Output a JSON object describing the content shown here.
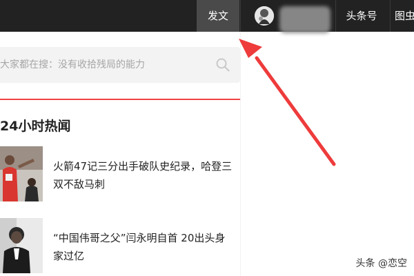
{
  "topbar": {
    "publish_label": "发文",
    "toutiao_label": "头条号",
    "partial_label": "图虫"
  },
  "search": {
    "placeholder": "大家都在搜：没有收拾残局的能力"
  },
  "hot": {
    "title": "24小时热闻",
    "items": [
      {
        "title": "火箭47记三分出手破队史纪录，哈登三双不敌马刺"
      },
      {
        "title": "“中国伟哥之父”闫永明自首 20出头身家过亿"
      }
    ]
  },
  "watermark": "头条 @恋空",
  "colors": {
    "topbar": "#222222",
    "publish_bg": "#4a4a4a",
    "accent_red": "#f04142",
    "arrow": "#ee3b3b"
  }
}
